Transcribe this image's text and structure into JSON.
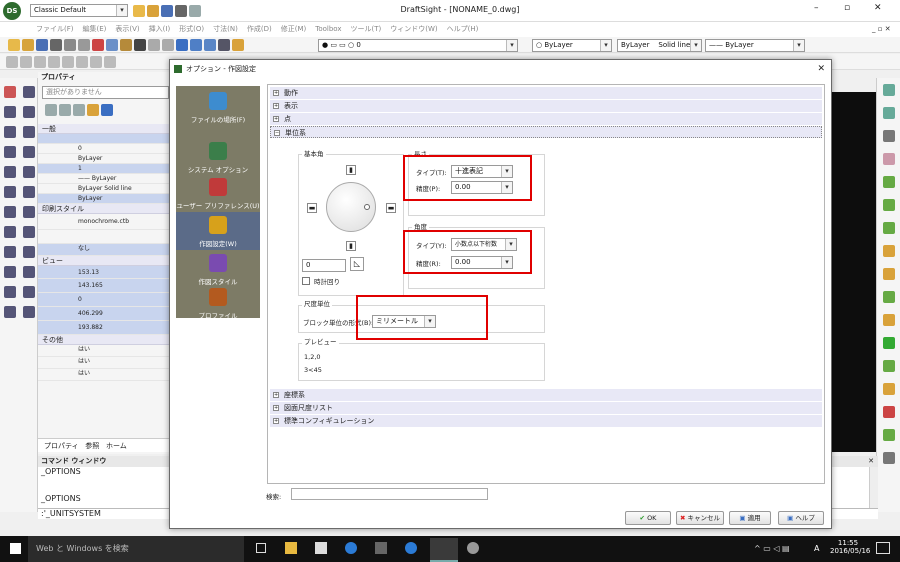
{
  "app": {
    "workspace": "Classic Default",
    "title": "DraftSight - [NONAME_0.dwg]",
    "win_min": "–",
    "win_max": "▫",
    "win_close": "✕",
    "inner_controls": "_ ▫ ✕"
  },
  "menu": [
    "ファイル(F)",
    "編集(E)",
    "表示(V)",
    "挿入(I)",
    "形式(O)",
    "寸法(N)",
    "作成(D)",
    "修正(M)",
    "Toolbox",
    "ツール(T)",
    "ウィンドウ(W)",
    "ヘルプ(H)"
  ],
  "toolbar": {
    "layer_value": "0",
    "color_value": "ByLayer",
    "linetype_value": "ByLayer",
    "linestyle_name": "Solid line",
    "lineweight_value": "ByLayer"
  },
  "properties": {
    "title": "プロパティ",
    "selection": "選択がありません",
    "groups": {
      "general": "一般",
      "print": "印刷スタイル",
      "view": "ビュー",
      "other": "その他"
    },
    "general_rows": [
      "",
      "0",
      "ByLayer",
      "1",
      "—— ByLayer",
      "ByLayer   Solid line",
      "ByLayer"
    ],
    "print_rows": [
      "monochrome.ctb",
      "",
      "なし"
    ],
    "view_rows": [
      "153.13",
      "143.165",
      "0",
      "406.299",
      "193.882"
    ],
    "other_rows": [
      "はい",
      "はい",
      "はい"
    ],
    "tabs": [
      "プロパティ",
      "参照",
      "ホーム"
    ]
  },
  "command": {
    "title": "コマンド ウィンドウ",
    "lines": [
      "_OPTIONS",
      "",
      "_OPTIONS",
      ":'_UNITSYSTEM"
    ],
    "close": "✕"
  },
  "dialog": {
    "title": "オプション - 作図設定",
    "close": "✕",
    "nav": [
      {
        "label": "ファイルの場所(F)",
        "color": "#3d8ccf"
      },
      {
        "label": "システム オプション",
        "color": "#3b7e4a"
      },
      {
        "label": "ユーザー プリファレンス(U)",
        "color": "#c03a3a"
      },
      {
        "label": "作図設定(W)",
        "color": "#d7a11b"
      },
      {
        "label": "作図スタイル",
        "color": "#7a4bb0"
      },
      {
        "label": "プロファイル",
        "color": "#b35a1f"
      }
    ],
    "sections": {
      "behavior": "動作",
      "display": "表示",
      "point": "点",
      "units": "単位系",
      "coords": "座標系",
      "dimensions": "図面尺度リスト",
      "standards": "標準コンフィギュレーション"
    },
    "base_angle": {
      "label": "基本角",
      "value": "0",
      "clockwise": "時計回り"
    },
    "length": {
      "label": "長さ",
      "type_label": "タイプ(T):",
      "type_value": "十進表記",
      "precision_label": "精度(P):",
      "precision_value": "0.00"
    },
    "angle": {
      "label": "角度",
      "type_label": "タイプ(Y):",
      "type_value": "小数点以下桁数",
      "precision_label": "精度(R):",
      "precision_value": "0.00"
    },
    "scale": {
      "label": "尺度単位",
      "block_label": "ブロック単位の形式(B):",
      "block_value": "ミリメートル"
    },
    "preview": {
      "label": "プレビュー",
      "line1": "1,2,0",
      "line2": "3<45"
    },
    "search_label": "検索:",
    "buttons": {
      "ok": "OK",
      "cancel": "キャンセル",
      "apply": "適用",
      "help": "ヘルプ"
    }
  },
  "taskbar": {
    "search": "Web と Windows を検索",
    "time": "11:55",
    "date": "2016/05/16",
    "ime": "A"
  }
}
